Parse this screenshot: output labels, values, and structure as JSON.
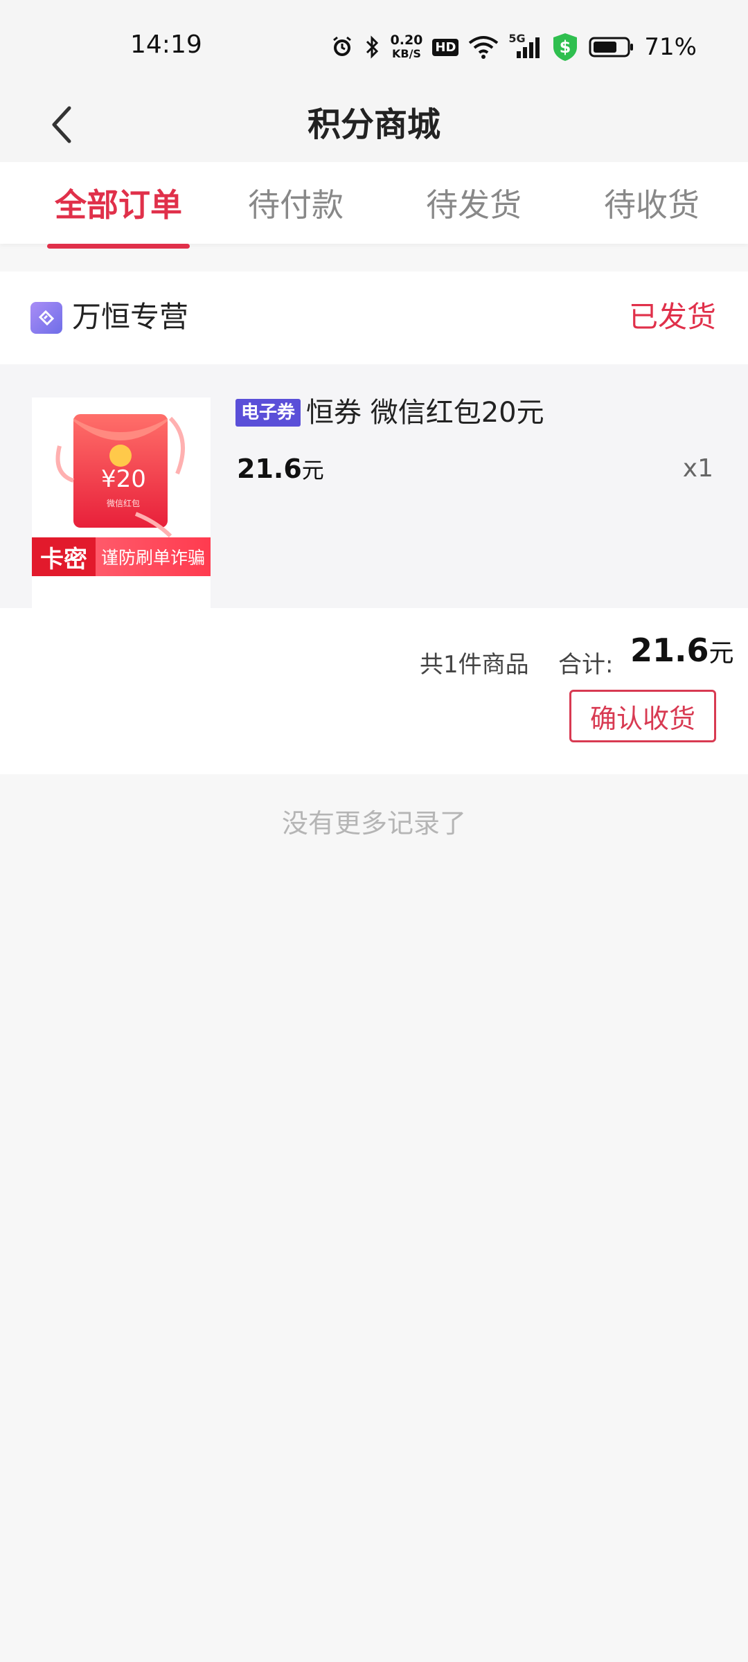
{
  "status_bar": {
    "time": "14:19",
    "net_speed_value": "0.20",
    "net_speed_unit": "KB/S",
    "hd_label": "HD",
    "network_type": "5G",
    "battery": "71%"
  },
  "header": {
    "title": "积分商城",
    "back_icon": "chevron-left-icon"
  },
  "tabs": [
    {
      "label": "全部订单",
      "active": true
    },
    {
      "label": "待付款",
      "active": false
    },
    {
      "label": "待发货",
      "active": false
    },
    {
      "label": "待收货",
      "active": false
    }
  ],
  "order": {
    "store_name": "万恒专营",
    "status": "已发货",
    "goods": {
      "tag": "电子券",
      "title": "恒券 微信红包20元",
      "price": "21.6",
      "price_unit": "元",
      "qty": "x1",
      "thumb_amount": "¥20",
      "thumb_caption": "微信红包",
      "thumb_tag_left": "卡密",
      "thumb_tag_right": "谨防刷单诈骗"
    },
    "summary": {
      "count_text": "共1件商品",
      "total_label": "合计:",
      "total_value": "21.6",
      "total_unit": "元"
    },
    "confirm_button": "确认收货"
  },
  "footer_text": "没有更多记录了",
  "colors": {
    "accent": "#e0304a",
    "tag_purple": "#5a4fd8"
  }
}
